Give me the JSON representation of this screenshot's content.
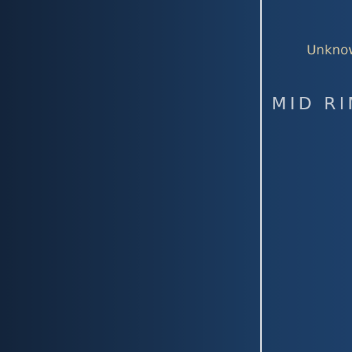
{
  "right_panel": {
    "subtitle": "Unknow",
    "title": "MID RIM"
  }
}
